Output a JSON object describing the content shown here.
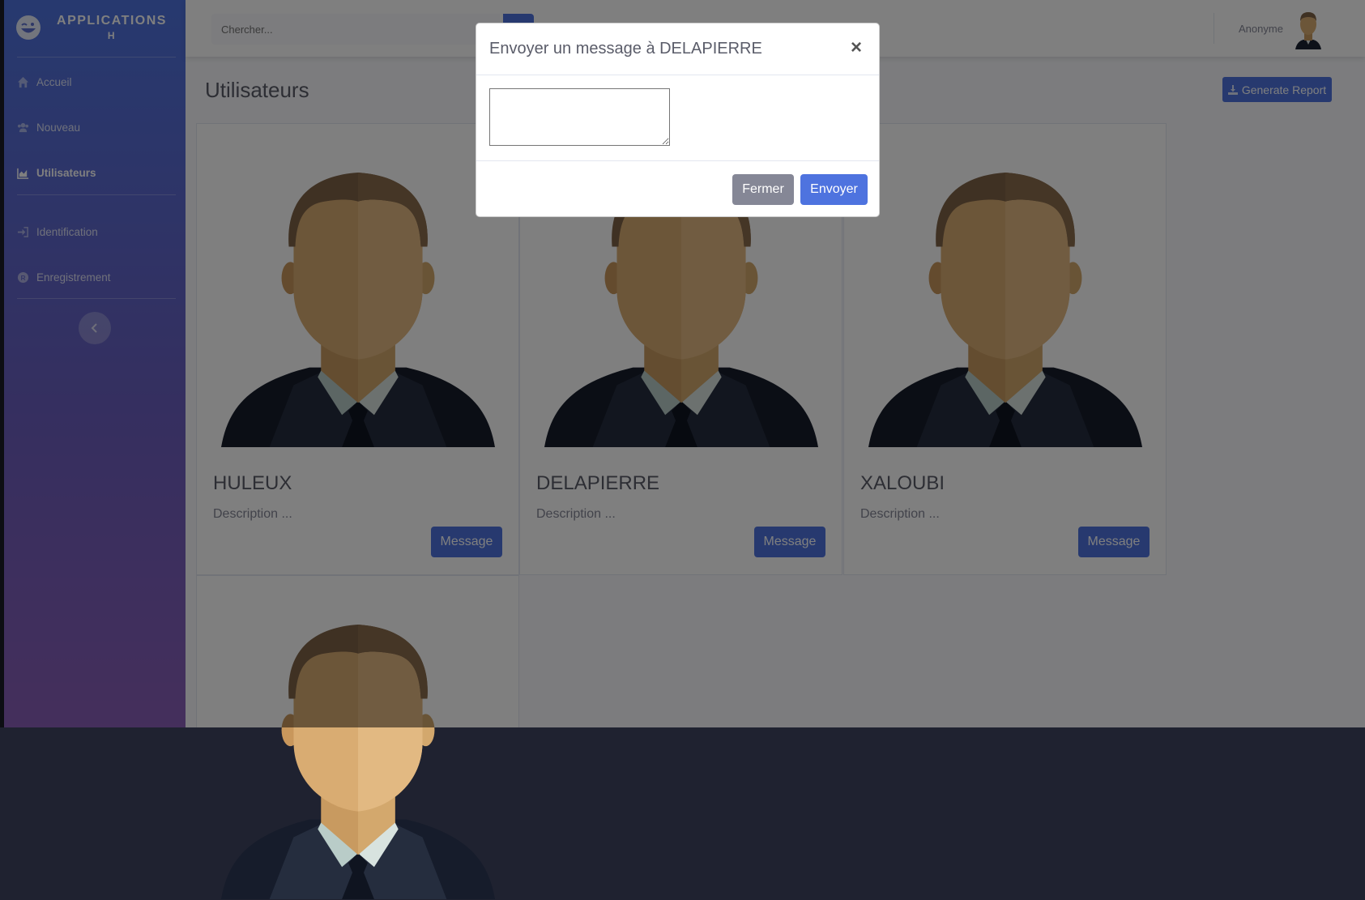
{
  "brand": {
    "line1": "APPLICATIONS",
    "line2": "H",
    "icon": "laugh-wink-icon"
  },
  "sidebar": {
    "items": [
      {
        "label": "Accueil",
        "icon": "home-icon",
        "active": false
      },
      {
        "label": "Nouveau",
        "icon": "users-icon",
        "active": false
      },
      {
        "label": "Utilisateurs",
        "icon": "chart-area-icon",
        "active": true
      },
      {
        "label": "Identification",
        "icon": "sign-in-icon",
        "active": false
      },
      {
        "label": "Enregistrement",
        "icon": "registered-icon",
        "active": false
      }
    ],
    "toggle_icon": "chevron-left-icon"
  },
  "topbar": {
    "search_placeholder": "Chercher...",
    "username": "Anonyme"
  },
  "main": {
    "title": "Utilisateurs",
    "report_button": "Generate Report",
    "users": [
      {
        "name": "HULEUX",
        "description": "Description ...",
        "button": "Message"
      },
      {
        "name": "DELAPIERRE",
        "description": "Description ...",
        "button": "Message"
      },
      {
        "name": "XALOUBI",
        "description": "Description ...",
        "button": "Message"
      },
      {
        "name": "",
        "description": "",
        "button": ""
      }
    ]
  },
  "modal": {
    "title": "Envoyer un message à DELAPIERRE",
    "close": "×",
    "message_value": "",
    "close_button": "Fermer",
    "send_button": "Envoyer"
  },
  "colors": {
    "primary": "#4e73df",
    "secondary": "#858796",
    "sidebar_top": "#4e73df",
    "sidebar_bottom": "#8a5fb8"
  }
}
